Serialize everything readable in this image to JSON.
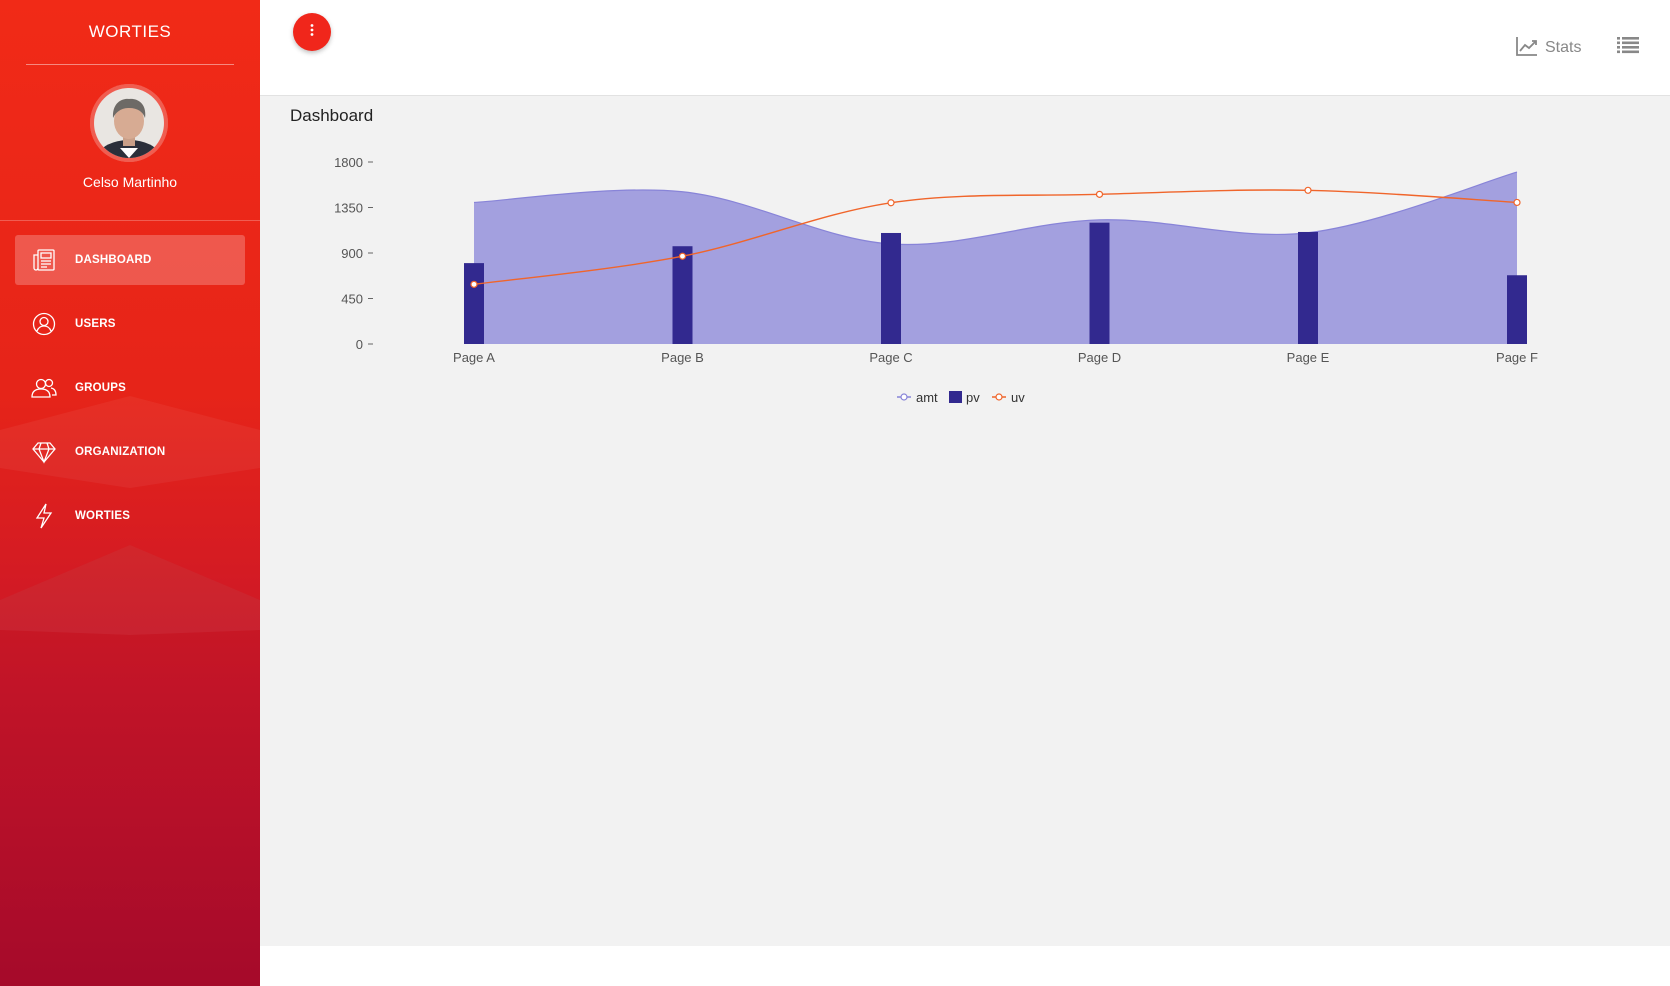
{
  "sidebar": {
    "brand": "WORTIES",
    "user_name": "Celso Martinho",
    "items": [
      {
        "label": "DASHBOARD",
        "icon": "newspaper-icon",
        "active": true
      },
      {
        "label": "USERS",
        "icon": "user-circle-icon",
        "active": false
      },
      {
        "label": "GROUPS",
        "icon": "users-icon",
        "active": false
      },
      {
        "label": "ORGANIZATION",
        "icon": "diamond-icon",
        "active": false
      },
      {
        "label": "WORTIES",
        "icon": "bolt-icon",
        "active": false
      }
    ]
  },
  "topbar": {
    "menu_icon": "vertical-dots-icon",
    "stats_label": "Stats",
    "stats_icon": "line-chart-icon",
    "list_icon": "list-icon"
  },
  "main": {
    "title": "Dashboard"
  },
  "colors": {
    "accent": "#f0261b",
    "amt": "#8884d8",
    "pv": "#32298f",
    "uv": "#f0652b"
  },
  "chart_data": {
    "type": "bar",
    "categories": [
      "Page A",
      "Page B",
      "Page C",
      "Page D",
      "Page E",
      "Page F"
    ],
    "ylim": [
      0,
      1800
    ],
    "yticks": [
      0,
      450,
      900,
      1350,
      1800
    ],
    "series": [
      {
        "name": "amt",
        "type": "area",
        "values": [
          1400,
          1506,
          989,
          1228,
          1100,
          1700
        ]
      },
      {
        "name": "pv",
        "type": "bar",
        "values": [
          800,
          967,
          1098,
          1200,
          1108,
          680
        ]
      },
      {
        "name": "uv",
        "type": "line",
        "values": [
          590,
          868,
          1397,
          1480,
          1520,
          1400
        ]
      }
    ],
    "legend": [
      "amt",
      "pv",
      "uv"
    ],
    "legend_position": "bottom-center",
    "grid": false
  }
}
